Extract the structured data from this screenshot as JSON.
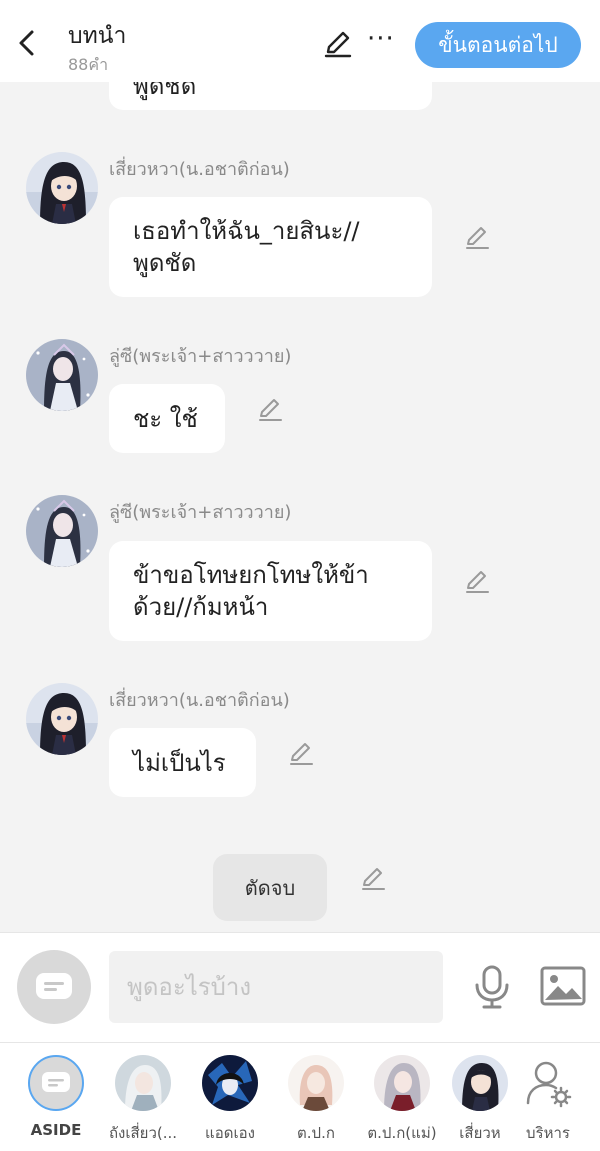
{
  "header": {
    "title": "บทนำ",
    "word_count": "88คำ",
    "next_button": "ขั้นตอนต่อไป",
    "more_label": "···"
  },
  "chat": {
    "partial_bubble_text": "พูดชัด",
    "messages": [
      {
        "name": "เสี่ยวหวา(น.อชาติก่อน)",
        "text_line1": "เธอทำให้ฉัน_ายสินะ//",
        "text_line2": "พูดชัด",
        "avatar": "girl-dark-hair"
      },
      {
        "name": "ลู่ซี(พระเจ้า+สาวววาย)",
        "text_line1": "ชะ ใช้",
        "avatar": "girl-silver-snow"
      },
      {
        "name": "ลู่ซี(พระเจ้า+สาวววาย)",
        "text_line1": "ข้าขอโทษยกโทษให้ข้า",
        "text_line2": "ด้วย//ก้มหน้า",
        "avatar": "girl-silver-snow"
      },
      {
        "name": "เสี่ยวหวา(น.อชาติก่อน)",
        "text_line1": "ไม่เป็นไร",
        "avatar": "girl-dark-hair"
      }
    ],
    "end_button": "ตัดจบ"
  },
  "composer": {
    "placeholder": "พูดอะไรบ้าง",
    "value": ""
  },
  "characters": [
    {
      "label": "ASIDE",
      "icon": "chat-bubble-icon"
    },
    {
      "label": "ถังเสี่ยว(...",
      "avatar": "boy-white-hair"
    },
    {
      "label": "แอดเอง",
      "avatar": "dark-blue-art"
    },
    {
      "label": "ต.ป.ก",
      "avatar": "girl-pink-hair"
    },
    {
      "label": "ต.ป.ก(แม่)",
      "avatar": "girl-silver-hair"
    },
    {
      "label": "เสี่ยวห",
      "avatar": "girl-dark-hair"
    },
    {
      "label": "บริหาร",
      "icon": "manage-user-icon"
    }
  ],
  "colors": {
    "accent": "#5aa7f0",
    "background": "#f3f3f3",
    "bubble": "#ffffff",
    "name_text": "#8a8a8a"
  }
}
